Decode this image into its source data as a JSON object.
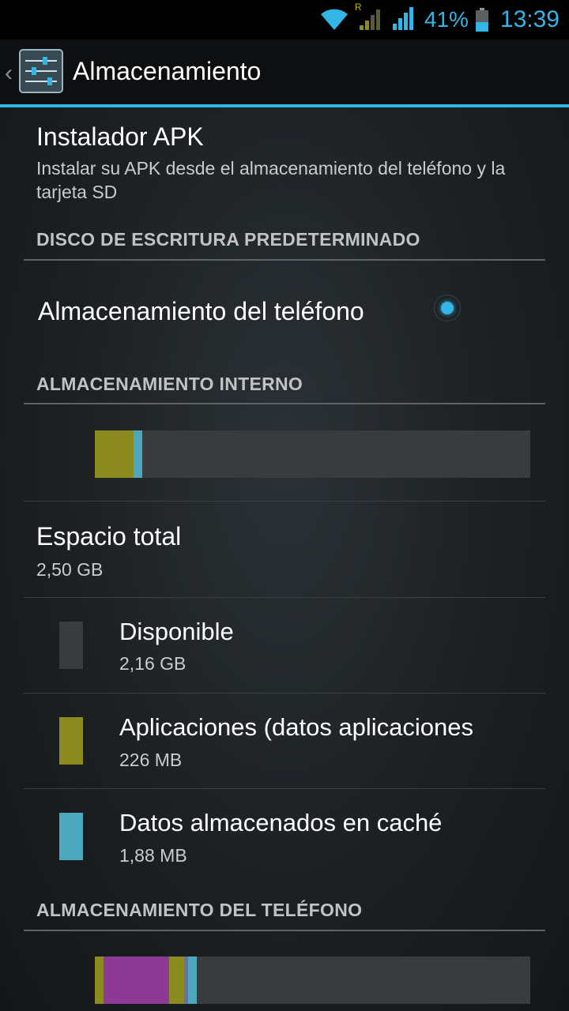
{
  "status_bar": {
    "battery_percent": "41%",
    "time": "13:39",
    "accent_color": "#33b5e5",
    "roaming_label": "R"
  },
  "action_bar": {
    "title": "Almacenamiento",
    "app_icon": "settings-sliders-icon"
  },
  "apk_installer": {
    "title": "Instalador APK",
    "subtitle": "Instalar su APK desde el almacenamiento del teléfono y la tarjeta SD"
  },
  "default_write_disk": {
    "header": "DISCO DE ESCRITURA PREDETERMINADO",
    "option_label": "Almacenamiento del teléfono",
    "selected": true
  },
  "internal_storage": {
    "header": "ALMACENAMIENTO INTERNO",
    "usage_segments": [
      {
        "name": "Aplicaciones",
        "fraction": 0.089,
        "color": "#8b8b20"
      },
      {
        "name": "Datos almacenados en caché",
        "fraction": 0.02,
        "color": "#4ca9bd"
      }
    ],
    "total": {
      "label": "Espacio total",
      "value": "2,50 GB"
    },
    "items": [
      {
        "label": "Disponible",
        "value": "2,16 GB",
        "color": "#3a3b3c"
      },
      {
        "label": "Aplicaciones (datos aplicaciones",
        "value": "226 MB",
        "color": "#8b8b20"
      },
      {
        "label": "Datos almacenados en caché",
        "value": "1,88 MB",
        "color": "#4ca9bd"
      }
    ]
  },
  "phone_storage": {
    "header": "ALMACENAMIENTO DEL TELÉFONO",
    "usage_segments": [
      {
        "fraction": 0.02,
        "color": "#8b8b20"
      },
      {
        "fraction": 0.15,
        "color": "#8d3a96"
      },
      {
        "fraction": 0.035,
        "color": "#8b8b20"
      },
      {
        "fraction": 0.01,
        "color": "#6b6ea8"
      },
      {
        "fraction": 0.02,
        "color": "#4ca9bd"
      }
    ]
  }
}
